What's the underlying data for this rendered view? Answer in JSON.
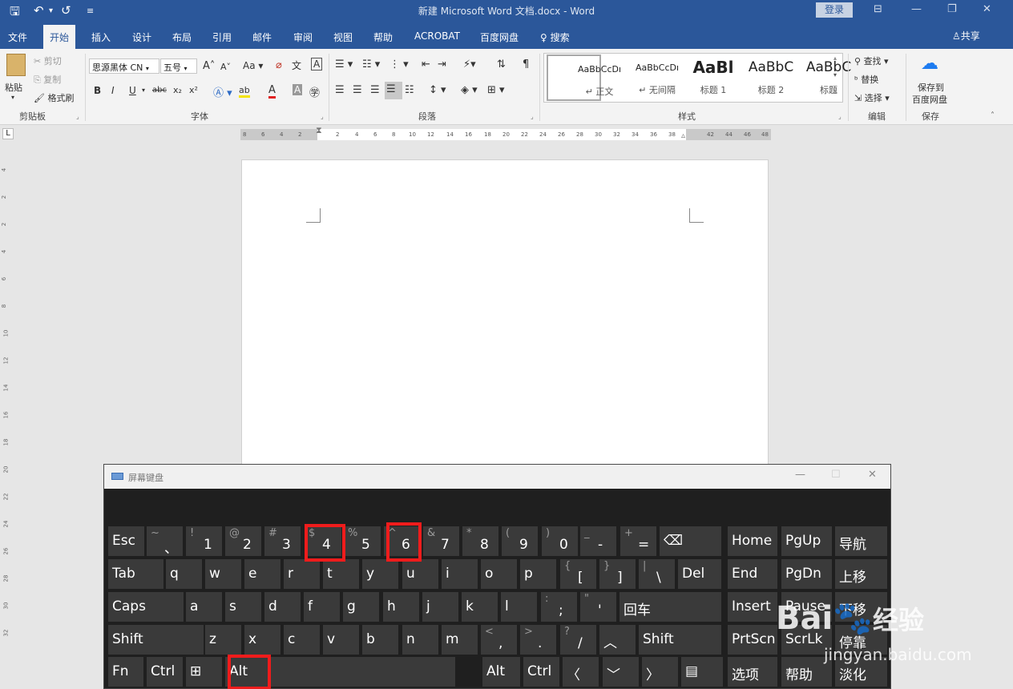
{
  "window": {
    "title": "新建 Microsoft Word 文档.docx  -  Word",
    "login": "登录",
    "quick_access": {
      "save": "🖫",
      "undo": "↶",
      "undo_arrow": "▾",
      "redo": "↺",
      "more": "≡"
    },
    "controls": {
      "ribbon_options": "⊟",
      "minimize": "—",
      "restore": "❐",
      "close": "✕"
    }
  },
  "ribbon_tabs": [
    "文件",
    "开始",
    "插入",
    "设计",
    "布局",
    "引用",
    "邮件",
    "审阅",
    "视图",
    "帮助",
    "ACROBAT",
    "百度网盘"
  ],
  "search_tab": "搜索",
  "share": "共享",
  "clipboard": {
    "paste": "粘贴",
    "cut": "剪切",
    "copy": "复制",
    "format_painter": "格式刷",
    "label": "剪贴板"
  },
  "font": {
    "font_name": "思源黑体 CN",
    "font_size": "五号",
    "grow": "A",
    "shrink": "A",
    "change_case": "Aa",
    "bold": "B",
    "italic": "I",
    "underline": "U",
    "strike": "abc",
    "sub": "x₂",
    "sup": "x²",
    "highlight": "ab",
    "color": "A",
    "label": "字体"
  },
  "paragraph": {
    "label": "段落"
  },
  "styles": {
    "items": [
      {
        "sample": "AaBbCcDı",
        "name": "↵ 正文"
      },
      {
        "sample": "AaBbCcDı",
        "name": "↵ 无间隔"
      },
      {
        "sample": "AaBl",
        "name": "标题 1"
      },
      {
        "sample": "AaBbC",
        "name": "标题 2"
      },
      {
        "sample": "AaBbC",
        "name": "标题"
      }
    ],
    "label": "样式"
  },
  "editing": {
    "find": "查找",
    "replace": "替换",
    "select": "选择",
    "label": "编辑"
  },
  "save_group": {
    "save_to_baidu_line1": "保存到",
    "save_to_baidu_line2": "百度网盘",
    "label": "保存"
  },
  "ruler": {
    "corner": "L",
    "numbers": [
      "8",
      "6",
      "4",
      "2",
      "2",
      "4",
      "6",
      "8",
      "10",
      "12",
      "14",
      "16",
      "18",
      "20",
      "22",
      "24",
      "26",
      "28",
      "30",
      "32",
      "34",
      "36",
      "38",
      "42",
      "44",
      "46",
      "48"
    ],
    "vnumbers": [
      "4",
      "2",
      "2",
      "4",
      "6",
      "8",
      "10",
      "12",
      "14",
      "16",
      "18",
      "20",
      "22",
      "24",
      "26",
      "28",
      "30",
      "32"
    ]
  },
  "osk": {
    "title": "屏幕键盘",
    "rows": [
      [
        {
          "m": "Esc"
        },
        {
          "s": "~",
          "b": "、"
        },
        {
          "s": "!",
          "b": "1"
        },
        {
          "s": "@",
          "b": "2"
        },
        {
          "s": "#",
          "b": "3"
        },
        {
          "s": "$",
          "b": "4"
        },
        {
          "s": "%",
          "b": "5"
        },
        {
          "s": "^",
          "b": "6"
        },
        {
          "s": "&",
          "b": "7"
        },
        {
          "s": "*",
          "b": "8"
        },
        {
          "s": "(",
          "b": "9"
        },
        {
          "s": ")",
          "b": "0"
        },
        {
          "s": "_",
          "b": "-"
        },
        {
          "s": "+",
          "b": "="
        },
        {
          "m": "⌫"
        },
        {
          "m": "Home"
        },
        {
          "m": "PgUp"
        },
        {
          "m": "导航"
        }
      ],
      [
        {
          "m": "Tab"
        },
        {
          "m": "q"
        },
        {
          "m": "w"
        },
        {
          "m": "e"
        },
        {
          "m": "r"
        },
        {
          "m": "t"
        },
        {
          "m": "y"
        },
        {
          "m": "u"
        },
        {
          "m": "i"
        },
        {
          "m": "o"
        },
        {
          "m": "p"
        },
        {
          "s": "{",
          "b": "["
        },
        {
          "s": "}",
          "b": "]"
        },
        {
          "s": "|",
          "b": "\\"
        },
        {
          "m": "Del"
        },
        {
          "m": "End"
        },
        {
          "m": "PgDn"
        },
        {
          "m": "上移"
        }
      ],
      [
        {
          "m": "Caps"
        },
        {
          "m": "a"
        },
        {
          "m": "s"
        },
        {
          "m": "d"
        },
        {
          "m": "f"
        },
        {
          "m": "g"
        },
        {
          "m": "h"
        },
        {
          "m": "j"
        },
        {
          "m": "k"
        },
        {
          "m": "l"
        },
        {
          "s": ":",
          "b": ";"
        },
        {
          "s": "\"",
          "b": "'"
        },
        {
          "m": "回车"
        },
        {
          "m": "Insert"
        },
        {
          "m": "Pause"
        },
        {
          "m": "下移"
        }
      ],
      [
        {
          "m": "Shift"
        },
        {
          "m": "z"
        },
        {
          "m": "x"
        },
        {
          "m": "c"
        },
        {
          "m": "v"
        },
        {
          "m": "b"
        },
        {
          "m": "n"
        },
        {
          "m": "m"
        },
        {
          "s": "<",
          "b": ","
        },
        {
          "s": ">",
          "b": "."
        },
        {
          "s": "?",
          "b": "/"
        },
        {
          "m": "︿"
        },
        {
          "m": "Shift"
        },
        {
          "m": "PrtScn"
        },
        {
          "m": "ScrLk"
        },
        {
          "m": "停靠"
        }
      ],
      [
        {
          "m": "Fn"
        },
        {
          "m": "Ctrl"
        },
        {
          "m": "⊞"
        },
        {
          "m": "Alt"
        },
        {
          "m": ""
        },
        {
          "m": "Alt"
        },
        {
          "m": "Ctrl"
        },
        {
          "m": "〈"
        },
        {
          "m": "﹀"
        },
        {
          "m": "〉"
        },
        {
          "m": "▤"
        },
        {
          "m": "选项"
        },
        {
          "m": "帮助"
        },
        {
          "m": "淡化"
        }
      ]
    ]
  },
  "watermark": {
    "brand": "Bai",
    "brand2": "经验",
    "url": "jingyan.baidu.com"
  },
  "colors": {
    "accent": "#2b579a",
    "highlight_box": "#ef1c1c",
    "key_bg": "#3a3a3a"
  }
}
